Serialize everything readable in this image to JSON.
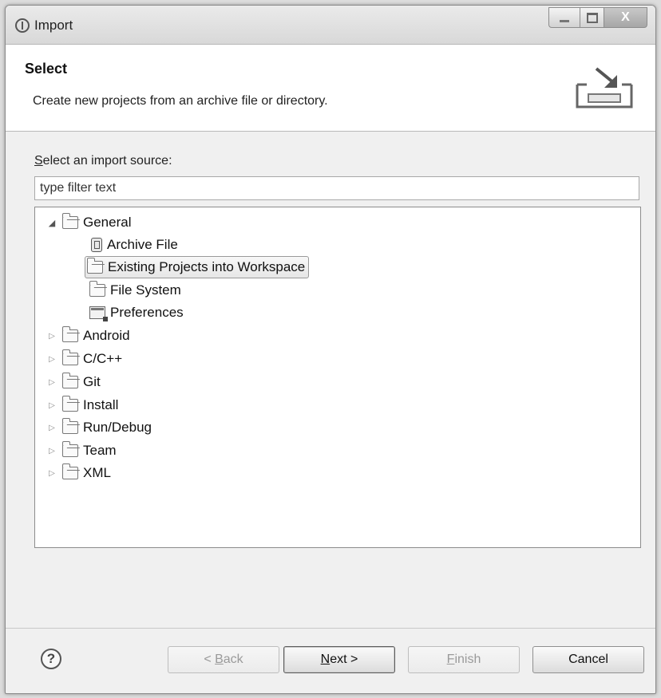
{
  "window": {
    "title": "Import",
    "controls": {
      "minimize": "minimize",
      "maximize": "maximize",
      "close": "X"
    }
  },
  "header": {
    "title": "Select",
    "description": "Create new projects from an archive file or directory.",
    "graphic_icon": "import-wizard-icon"
  },
  "body": {
    "source_label_prefix": "S",
    "source_label_rest": "elect an import source:",
    "filter_placeholder": "type filter text"
  },
  "tree": {
    "expanded_node": {
      "label": "General",
      "icon": "folder-icon",
      "twisty": "expanded"
    },
    "children": [
      {
        "label": "Archive File",
        "icon": "archive-icon"
      },
      {
        "label": "Existing Projects into Workspace",
        "icon": "folder-icon",
        "selected": true
      },
      {
        "label": "File System",
        "icon": "folder-icon"
      },
      {
        "label": "Preferences",
        "icon": "preferences-icon"
      }
    ],
    "collapsed_nodes": [
      {
        "label": "Android"
      },
      {
        "label": "C/C++"
      },
      {
        "label": "Git"
      },
      {
        "label": "Install"
      },
      {
        "label": "Run/Debug"
      },
      {
        "label": "Team"
      },
      {
        "label": "XML"
      }
    ]
  },
  "footer": {
    "help_glyph": "?",
    "back_prefix": "< ",
    "back_mnemonic": "B",
    "back_rest": "ack",
    "next_mnemonic": "N",
    "next_rest": "ext >",
    "finish_mnemonic": "F",
    "finish_rest": "inish",
    "cancel_label": "Cancel"
  }
}
